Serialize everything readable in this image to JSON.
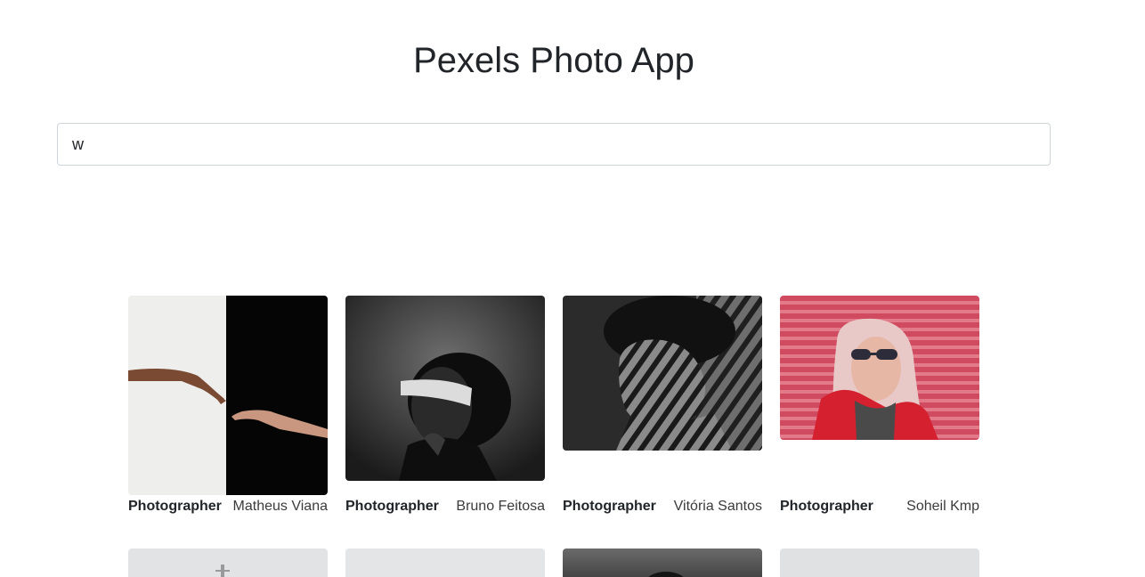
{
  "header": {
    "title": "Pexels Photo App"
  },
  "search": {
    "value": "w",
    "placeholder": ""
  },
  "photos": [
    {
      "label": "Photographer",
      "photographer": "Matheus Viana",
      "alt": "hands reaching across black and white wall"
    },
    {
      "label": "Photographer",
      "photographer": "Bruno Feitosa",
      "alt": "blindfolded person black and white portrait"
    },
    {
      "label": "Photographer",
      "photographer": "Vitória Santos",
      "alt": "man with striped shadow on face black and white"
    },
    {
      "label": "Photographer",
      "photographer": "Soheil Kmp",
      "alt": "woman with sunglasses against red wall"
    }
  ],
  "second_row": [
    {
      "tone": "light-gray"
    },
    {
      "tone": "light-gray"
    },
    {
      "tone": "dark-gray"
    },
    {
      "tone": "light-gray"
    }
  ]
}
